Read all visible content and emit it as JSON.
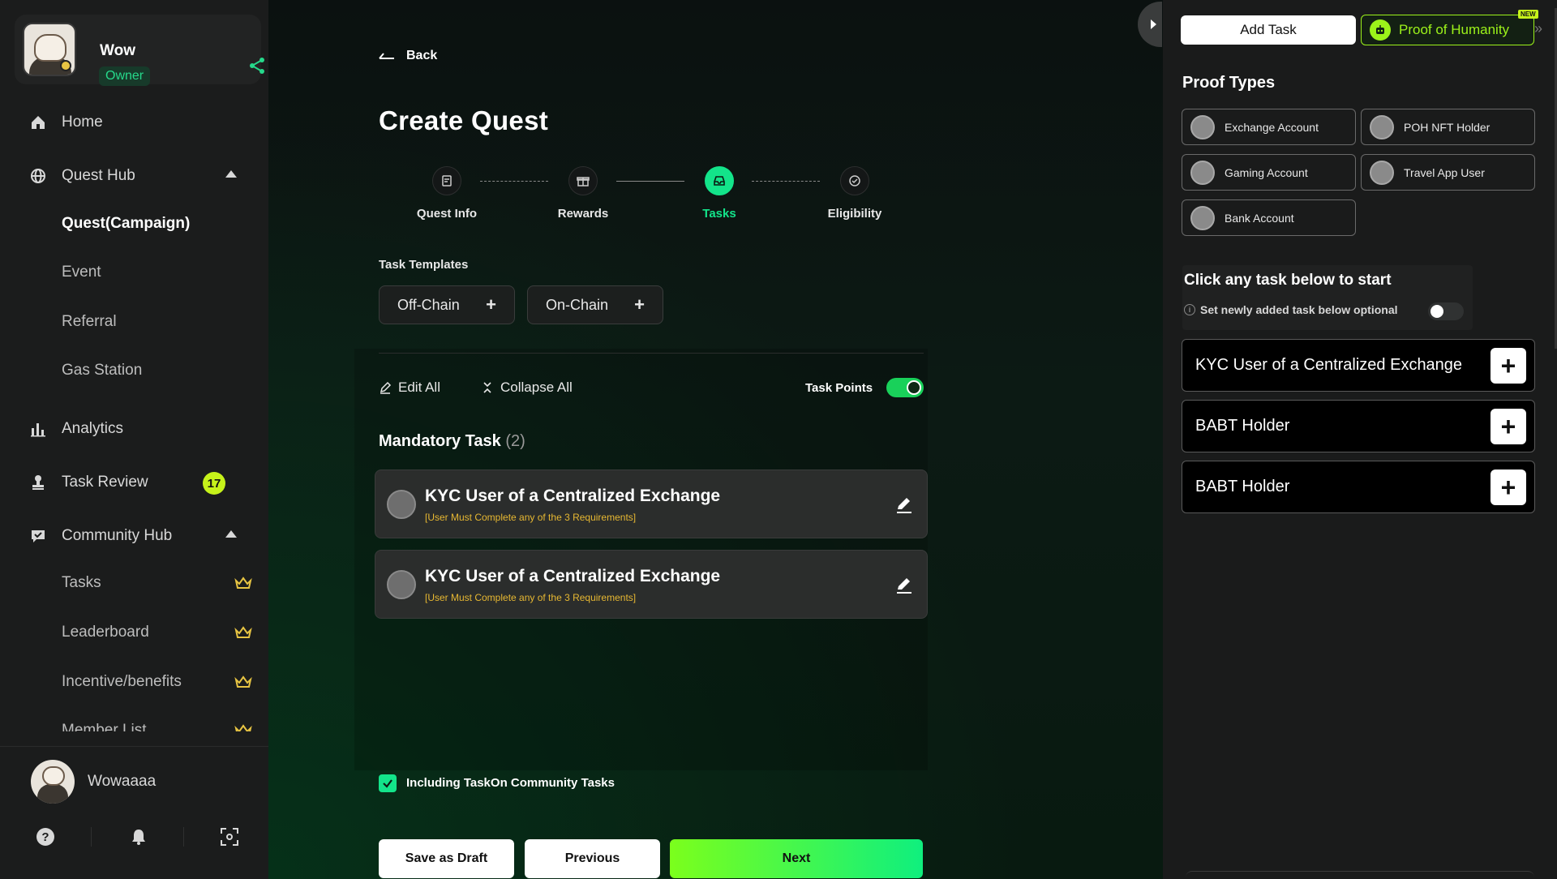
{
  "sidebar": {
    "profile": {
      "name": "Wow",
      "role": "Owner"
    },
    "nav": {
      "home": "Home",
      "quest_hub": "Quest Hub",
      "quest_campaign": "Quest(Campaign)",
      "event": "Event",
      "referral": "Referral",
      "gas_station": "Gas Station",
      "analytics": "Analytics",
      "task_review": "Task Review",
      "task_review_count": "17",
      "community_hub": "Community Hub",
      "tasks": "Tasks",
      "leaderboard": "Leaderboard",
      "incentive": "Incentive/benefits",
      "member_list": "Member List"
    },
    "user": {
      "name": "Wowaaaa"
    }
  },
  "main": {
    "back": "Back",
    "title": "Create Quest",
    "steps": [
      {
        "label": "Quest Info",
        "icon": "document-icon",
        "active": false
      },
      {
        "label": "Rewards",
        "icon": "gift-icon",
        "active": false
      },
      {
        "label": "Tasks",
        "icon": "inbox-icon",
        "active": true
      },
      {
        "label": "Eligibility",
        "icon": "check-circle-icon",
        "active": false
      }
    ],
    "task_templates_label": "Task Templates",
    "templates": [
      {
        "label": "Off-Chain"
      },
      {
        "label": "On-Chain"
      }
    ],
    "edit_all": "Edit All",
    "collapse_all": "Collapse All",
    "task_points_label": "Task Points",
    "task_points_enabled": true,
    "mandatory_title": "Mandatory Task",
    "mandatory_count": "(2)",
    "tasks": [
      {
        "title": "KYC User of a Centralized Exchange",
        "subtitle": "[User Must Complete any of the 3 Requirements]"
      },
      {
        "title": "KYC User of a Centralized Exchange",
        "subtitle": "[User Must Complete any of the 3 Requirements]"
      }
    ],
    "include_community_label": "Including TaskOn Community Tasks",
    "include_community_checked": true,
    "buttons": {
      "save_draft": "Save as Draft",
      "previous": "Previous",
      "next": "Next"
    }
  },
  "right_panel": {
    "tabs": {
      "add_task": "Add Task",
      "poh": "Proof of Humanity",
      "new_tag": "NEW"
    },
    "proof_types_title": "Proof Types",
    "proof_types": [
      "Exchange Account",
      "POH NFT Holder",
      "Gaming Account",
      "Travel App User",
      "Bank Account"
    ],
    "hint_title": "Click any task below to start",
    "optional_label": "Set newly added task below optional",
    "optional_enabled": false,
    "task_options": [
      "KYC User of a Centralized Exchange",
      "BABT Holder",
      "BABT Holder"
    ]
  },
  "colors": {
    "accent": "#13e48a",
    "poh_green": "#9cf21a",
    "warning_text": "#e7b832"
  }
}
